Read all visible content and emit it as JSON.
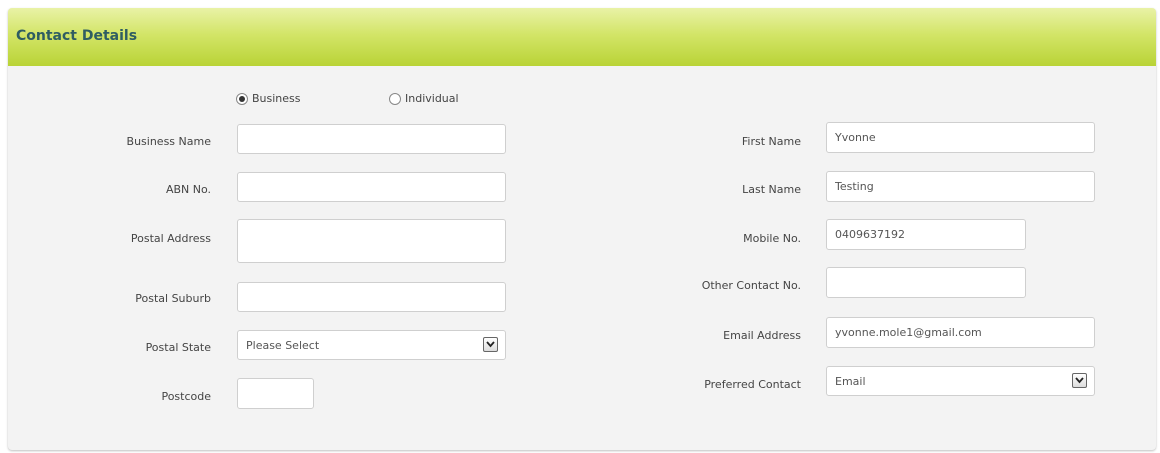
{
  "section": {
    "title": "Contact Details"
  },
  "customer_type": {
    "options": [
      {
        "label": "Business",
        "checked": true
      },
      {
        "label": "Individual",
        "checked": false
      }
    ]
  },
  "left": {
    "business_name": {
      "label": "Business Name",
      "value": ""
    },
    "abn": {
      "label": "ABN No.",
      "value": ""
    },
    "postal_address": {
      "label": "Postal Address",
      "value": ""
    },
    "postal_suburb": {
      "label": "Postal Suburb",
      "value": ""
    },
    "postal_state": {
      "label": "Postal State",
      "selected": "Please Select"
    },
    "postcode": {
      "label": "Postcode",
      "value": ""
    }
  },
  "right": {
    "first_name": {
      "label": "First Name",
      "value": "Yvonne"
    },
    "last_name": {
      "label": "Last Name",
      "value": "Testing"
    },
    "mobile": {
      "label": "Mobile No.",
      "value": "0409637192"
    },
    "other_contact": {
      "label": "Other Contact No.",
      "value": ""
    },
    "email": {
      "label": "Email Address",
      "value": "yvonne.mole1@gmail.com"
    },
    "preferred_contact": {
      "label": "Preferred Contact",
      "selected": "Email"
    }
  }
}
